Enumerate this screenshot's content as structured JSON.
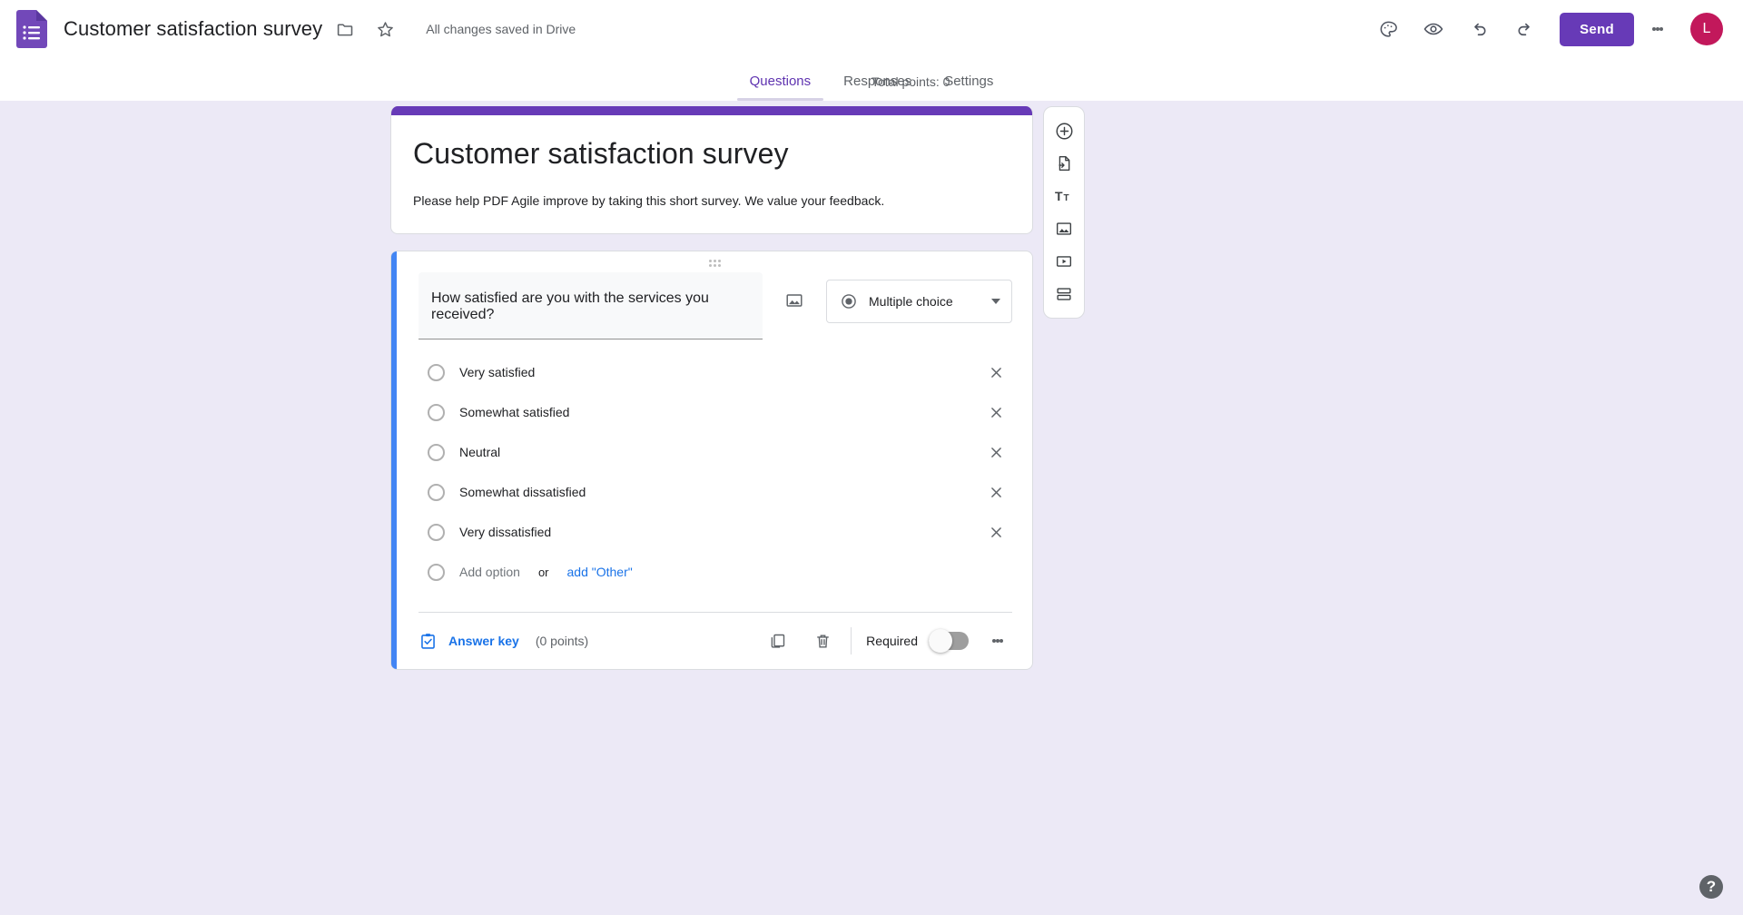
{
  "app": {
    "logo_icon": "google-forms-icon",
    "doc_title": "Customer satisfaction survey",
    "move_folder_icon": "folder-icon",
    "star_icon": "star-icon",
    "save_status": "All changes saved in Drive"
  },
  "toolbar": {
    "theme_icon": "palette-icon",
    "preview_icon": "eye-icon",
    "undo_icon": "undo-icon",
    "redo_icon": "redo-icon",
    "send_label": "Send",
    "more_icon": "more-vert-icon",
    "avatar_initial": "L",
    "avatar_color": "#c2185b",
    "accent_color": "#673ab7"
  },
  "tabs": [
    {
      "label": "Questions",
      "active": true
    },
    {
      "label": "Responses",
      "active": false
    },
    {
      "label": "Settings",
      "active": false
    }
  ],
  "total_points": "Total points: 0",
  "form_header": {
    "title": "Customer satisfaction survey",
    "description": "Please help PDF Agile improve by taking this short survey. We value your feedback."
  },
  "question": {
    "drag_handle_icon": "drag-handle-icon",
    "text": "How satisfied are you with the services you received?",
    "image_icon": "add-image-icon",
    "type_icon": "radio-button-icon",
    "type_label": "Multiple choice",
    "caret_icon": "chevron-down-icon",
    "options": [
      {
        "label": "Very satisfied"
      },
      {
        "label": "Somewhat satisfied"
      },
      {
        "label": "Neutral"
      },
      {
        "label": "Somewhat dissatisfied"
      },
      {
        "label": "Very dissatisfied"
      }
    ],
    "remove_icon": "close-icon",
    "add_option_placeholder": "Add option",
    "or_text": "or",
    "add_other_label": "add \"Other\"",
    "footer": {
      "answer_key_icon": "answer-key-icon",
      "answer_key_label": "Answer key",
      "points_label": "(0 points)",
      "duplicate_icon": "duplicate-icon",
      "delete_icon": "trash-icon",
      "required_label": "Required",
      "required_on": false,
      "more_icon": "more-vert-icon"
    }
  },
  "side_toolbar": [
    {
      "icon": "add-question-icon"
    },
    {
      "icon": "import-questions-icon"
    },
    {
      "icon": "add-title-icon"
    },
    {
      "icon": "add-image-icon"
    },
    {
      "icon": "add-video-icon"
    },
    {
      "icon": "add-section-icon"
    }
  ],
  "help": {
    "icon": "help-icon",
    "label": "?"
  }
}
